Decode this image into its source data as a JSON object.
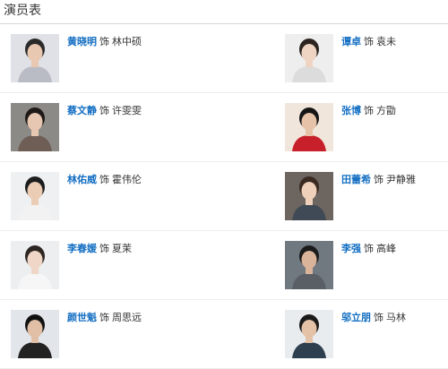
{
  "section": {
    "title": "演员表"
  },
  "as_word": "饰",
  "cast": [
    {
      "actor": "黄晓明",
      "role": "林中硕",
      "photo": "actor-photo-huang-xiaoming",
      "bg": "#dfe1e6",
      "hair": "#2a2a2a",
      "shirt": "#b9bcc4",
      "skin": "#e8c8b0"
    },
    {
      "actor": "谭卓",
      "role": "袁未",
      "photo": "actor-photo-tan-zhuo",
      "bg": "#eeeeee",
      "hair": "#2b2420",
      "shirt": "#dcdcdc",
      "skin": "#efd4c3"
    },
    {
      "actor": "蔡文静",
      "role": "许雯雯",
      "photo": "actor-photo-cai-wenjing",
      "bg": "#8c8a86",
      "hair": "#1f1a17",
      "shirt": "#6e5e55",
      "skin": "#e7c7b2"
    },
    {
      "actor": "张博",
      "role": "方勖",
      "photo": "actor-photo-zhang-bo",
      "bg": "#f1e6dc",
      "hair": "#151515",
      "shirt": "#c8202a",
      "skin": "#e6c3a8"
    },
    {
      "actor": "林佑威",
      "role": "霍伟伦",
      "photo": "actor-photo-lin-youwei",
      "bg": "#eef0f2",
      "hair": "#1d1d1d",
      "shirt": "#f2f2f2",
      "skin": "#ebcdb6"
    },
    {
      "actor": "田蕾希",
      "role": "尹静雅",
      "photo": "actor-photo-tian-leixi",
      "bg": "#6d6560",
      "hair": "#3a2a22",
      "shirt": "#3f4a56",
      "skin": "#efd0bb"
    },
    {
      "actor": "李春媛",
      "role": "夏茉",
      "photo": "actor-photo-li-chunyuan",
      "bg": "#eceef0",
      "hair": "#2d2522",
      "shirt": "#f6f6f6",
      "skin": "#f0d6c6"
    },
    {
      "actor": "李强",
      "role": "高峰",
      "photo": "actor-photo-li-qiang",
      "bg": "#707880",
      "hair": "#1b1b1b",
      "shirt": "#5a5f66",
      "skin": "#d9b49a"
    },
    {
      "actor": "颜世魁",
      "role": "周思远",
      "photo": "actor-photo-yan-shikui",
      "bg": "#e2e6ea",
      "hair": "#111111",
      "shirt": "#222222",
      "skin": "#e0bfa6"
    },
    {
      "actor": "邬立朋",
      "role": "马林",
      "photo": "actor-photo-wu-lipeng",
      "bg": "#e8ecef",
      "hair": "#1a1a1a",
      "shirt": "#2e3f50",
      "skin": "#e4c2a8"
    }
  ]
}
